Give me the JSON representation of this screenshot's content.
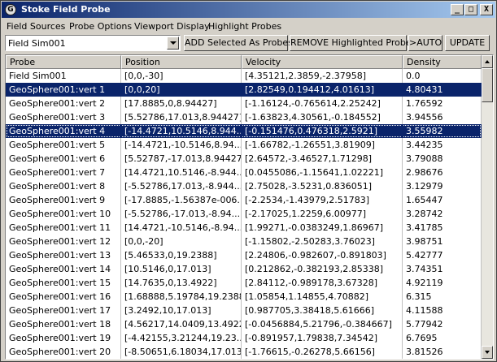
{
  "window": {
    "title": "Stoke Field Probe",
    "app_icon": "G",
    "controls": {
      "minimize": "_",
      "maximize": "□",
      "close": "X"
    }
  },
  "menu": [
    "Field Sources",
    "Probe Options",
    "Viewport Display",
    "Highlight Probes"
  ],
  "toolbar": {
    "source_value": "Field Sim001",
    "add_label": "ADD Selected As Probes",
    "remove_label": "REMOVE Highlighted Probes",
    "auto_label": ">AUTO",
    "update_label": "UPDATE"
  },
  "columns": [
    "Probe",
    "Position",
    "Velocity",
    "Density"
  ],
  "rows": [
    {
      "probe": "Field Sim001",
      "position": "[0,0,-30]",
      "velocity": "[4.35121,2.3859,-2.37958]",
      "density": "0.0",
      "selected": false
    },
    {
      "probe": "GeoSphere001:vert 1",
      "position": "[0,0,20]",
      "velocity": "[2.82549,0.194412,4.01613]",
      "density": "4.80431",
      "selected": true
    },
    {
      "probe": "GeoSphere001:vert 2",
      "position": "[17.8885,0,8.94427]",
      "velocity": "[-1.16124,-0.765614,2.25242]",
      "density": "1.76592",
      "selected": false
    },
    {
      "probe": "GeoSphere001:vert 3",
      "position": "[5.52786,17.013,8.94427]",
      "velocity": "[-1.63823,4.30561,-0.184552]",
      "density": "3.94556",
      "selected": false
    },
    {
      "probe": "GeoSphere001:vert 4",
      "position": "[-14.4721,10.5146,8.944...",
      "velocity": "[-0.151476,0.476318,2.5921]",
      "density": "3.55982",
      "selected": true
    },
    {
      "probe": "GeoSphere001:vert 5",
      "position": "[-14.4721,-10.5146,8.94...",
      "velocity": "[-1.66782,-1.26551,3.81909]",
      "density": "3.44235",
      "selected": false
    },
    {
      "probe": "GeoSphere001:vert 6",
      "position": "[5.52787,-17.013,8.94427]",
      "velocity": "[2.64572,-3.46527,1.71298]",
      "density": "3.79088",
      "selected": false
    },
    {
      "probe": "GeoSphere001:vert 7",
      "position": "[14.4721,10.5146,-8.944...",
      "velocity": "[0.0455086,-1.15641,1.02221]",
      "density": "2.98676",
      "selected": false
    },
    {
      "probe": "GeoSphere001:vert 8",
      "position": "[-5.52786,17.013,-8.944...",
      "velocity": "[2.75028,-3.5231,0.836051]",
      "density": "3.12979",
      "selected": false
    },
    {
      "probe": "GeoSphere001:vert 9",
      "position": "[-17.8885,-1.56387e-006...",
      "velocity": "[-2.2534,-1.43979,2.51783]",
      "density": "1.65447",
      "selected": false
    },
    {
      "probe": "GeoSphere001:vert 10",
      "position": "[-5.52786,-17.013,-8.94...",
      "velocity": "[-2.17025,1.2259,6.00977]",
      "density": "3.28742",
      "selected": false
    },
    {
      "probe": "GeoSphere001:vert 11",
      "position": "[14.4721,-10.5146,-8.94...",
      "velocity": "[1.99271,-0.0383249,1.86967]",
      "density": "3.41785",
      "selected": false
    },
    {
      "probe": "GeoSphere001:vert 12",
      "position": "[0,0,-20]",
      "velocity": "[-1.15802,-2.50283,3.76023]",
      "density": "3.98751",
      "selected": false
    },
    {
      "probe": "GeoSphere001:vert 13",
      "position": "[5.46533,0,19.2388]",
      "velocity": "[2.24806,-0.982607,-0.891803]",
      "density": "5.42777",
      "selected": false
    },
    {
      "probe": "GeoSphere001:vert 14",
      "position": "[10.5146,0,17.013]",
      "velocity": "[0.212862,-0.382193,2.85338]",
      "density": "3.74351",
      "selected": false
    },
    {
      "probe": "GeoSphere001:vert 15",
      "position": "[14.7635,0,13.4922]",
      "velocity": "[2.84112,-0.989178,3.67328]",
      "density": "4.92119",
      "selected": false
    },
    {
      "probe": "GeoSphere001:vert 16",
      "position": "[1.68888,5.19784,19.2388]",
      "velocity": "[1.05854,1.14855,4.70882]",
      "density": "6.315",
      "selected": false
    },
    {
      "probe": "GeoSphere001:vert 17",
      "position": "[3.2492,10,17.013]",
      "velocity": "[0.987705,3.38418,5.61666]",
      "density": "4.11588",
      "selected": false
    },
    {
      "probe": "GeoSphere001:vert 18",
      "position": "[4.56217,14.0409,13.4922]",
      "velocity": "[-0.0456884,5.21796,-0.384667]",
      "density": "5.77942",
      "selected": false
    },
    {
      "probe": "GeoSphere001:vert 19",
      "position": "[-4.42155,3.21244,19.23...",
      "velocity": "[-0.891957,1.79838,7.34542]",
      "density": "6.7695",
      "selected": false
    },
    {
      "probe": "GeoSphere001:vert 20",
      "position": "[-8.50651,6.18034,17.013]",
      "velocity": "[-1.76615,-0.26278,5.66156]",
      "density": "3.81526",
      "selected": false
    }
  ],
  "colors": {
    "selection": "#0a246a",
    "title_gradient_start": "#0a246a",
    "title_gradient_end": "#a6caf0",
    "chrome": "#d4d0c8"
  }
}
